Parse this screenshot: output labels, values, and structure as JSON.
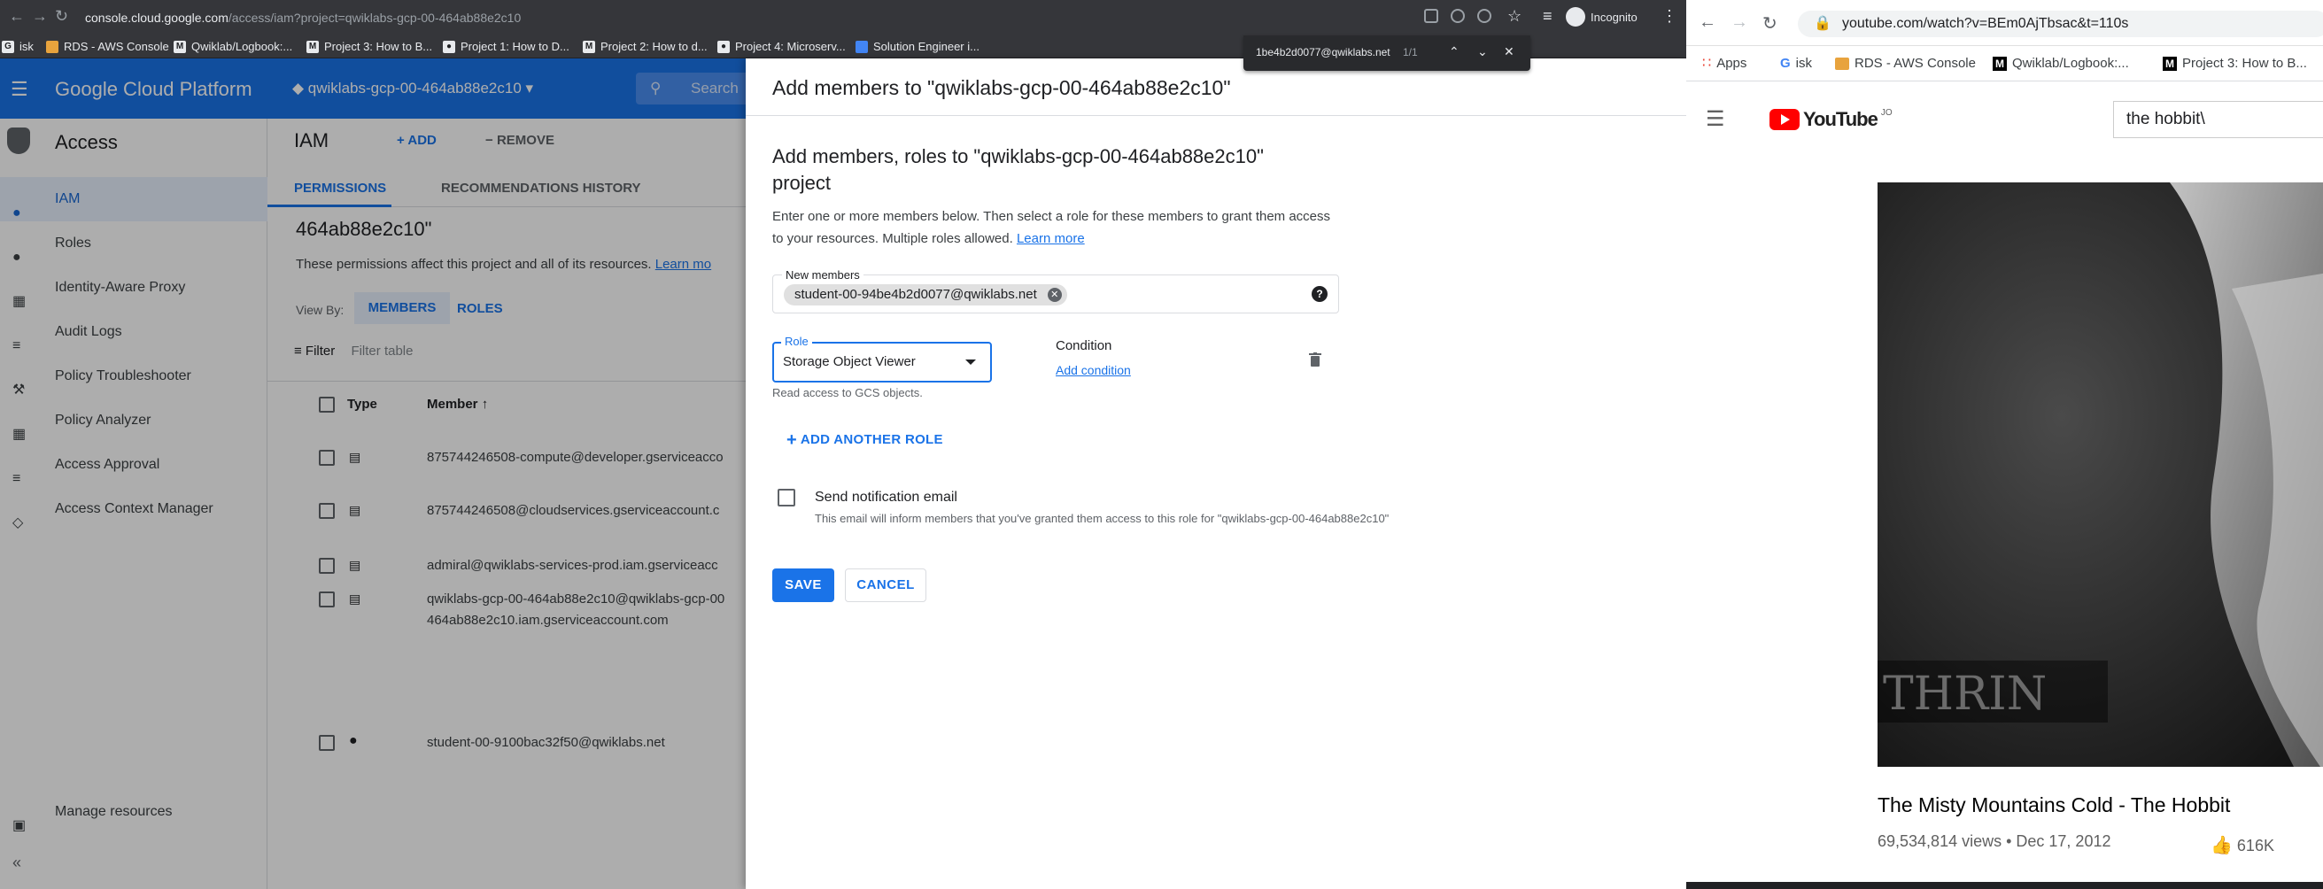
{
  "left_browser": {
    "url_host": "console.cloud.google.com",
    "url_path": "/access/iam?project=qwiklabs-gcp-00-464ab88e2c10",
    "incognito_label": "Incognito",
    "bookmarks": [
      "isk",
      "RDS - AWS Console",
      "Qwiklab/Logbook:...",
      "Project 3: How to B...",
      "Project 1: How to D...",
      "Project 2: How to d...",
      "Project 4: Microserv...",
      "Solution Engineer i..."
    ],
    "find_bar": {
      "query": "1be4b2d0077@qwiklabs.net",
      "count": "1/1"
    }
  },
  "gcp": {
    "brand": "Google Cloud Platform",
    "project_selector": "qwiklabs-gcp-00-464ab88e2c10",
    "search_placeholder": "Search",
    "sidebar_title": "Access",
    "sidebar_items": [
      "IAM",
      "Roles",
      "Identity-Aware Proxy",
      "Audit Logs",
      "Policy Troubleshooter",
      "Policy Analyzer",
      "Access Approval",
      "Access Context Manager"
    ],
    "sidebar_bottom": "Manage resources",
    "page_title": "IAM",
    "add_label": "ADD",
    "remove_label": "REMOVE",
    "tabs": [
      "PERMISSIONS",
      "RECOMMENDATIONS HISTORY"
    ],
    "heading_fragment": "464ab88e2c10\"",
    "perm_text": "These permissions affect this project and all of its resources.",
    "perm_link": "Learn mo",
    "view_by_label": "View By:",
    "view_members": "MEMBERS",
    "view_roles": "ROLES",
    "filter_label": "Filter",
    "filter_placeholder": "Filter table",
    "col_type": "Type",
    "col_member": "Member",
    "members": [
      "875744246508-compute@developer.gserviceacco",
      "875744246508@cloudservices.gserviceaccount.c",
      "admiral@qwiklabs-services-prod.iam.gserviceacc",
      "qwiklabs-gcp-00-464ab88e2c10@qwiklabs-gcp-00",
      "464ab88e2c10.iam.gserviceaccount.com",
      "student-00-9100bac32f50@qwiklabs.net"
    ]
  },
  "panel": {
    "title": "Add members to \"qwiklabs-gcp-00-464ab88e2c10\"",
    "heading": "Add members, roles to \"qwiklabs-gcp-00-464ab88e2c10\" project",
    "description": "Enter one or more members below. Then select a role for these members to grant them access to your resources. Multiple roles allowed.",
    "learn_more": "Learn more",
    "new_members_label": "New members",
    "member_chip": "student-00-94be4b2d0077@qwiklabs.net",
    "role_label": "Role",
    "role_value": "Storage Object Viewer",
    "role_help": "Read access to GCS objects.",
    "condition_label": "Condition",
    "add_condition": "Add condition",
    "add_another_role": "ADD ANOTHER ROLE",
    "notify_label": "Send notification email",
    "notify_help": "This email will inform members that you've granted them access to this role for \"qwiklabs-gcp-00-464ab88e2c10\"",
    "save": "SAVE",
    "cancel": "CANCEL"
  },
  "right_browser": {
    "url": "youtube.com/watch?v=BEm0AjTbsac&t=110s",
    "bookmarks": [
      "Apps",
      "isk",
      "RDS - AWS Console",
      "Qwiklab/Logbook:...",
      "Project 3: How to B..."
    ],
    "yt_brand": "YouTube",
    "yt_country": "JO",
    "search_value": "the hobbit\\",
    "video_overlay_text": "THRIN",
    "video_title": "The Misty Mountains Cold - The Hobbit",
    "video_meta": "69,534,814 views • Dec 17, 2012",
    "likes": "616K"
  },
  "colors": {
    "gcp_blue": "#1a73e8",
    "chrome_dark": "#35363a",
    "youtube_red": "#ff0000"
  }
}
